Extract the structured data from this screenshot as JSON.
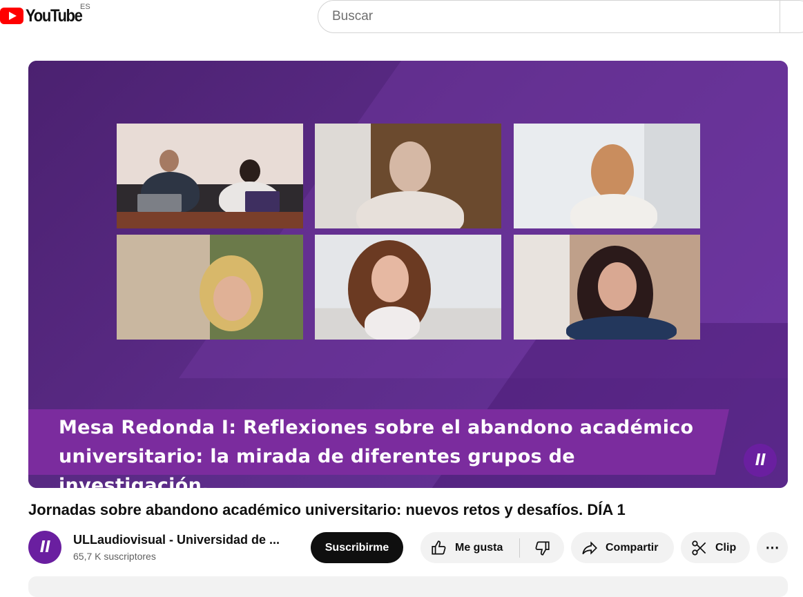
{
  "header": {
    "logo_text": "YouTube",
    "country_code": "ES",
    "search_placeholder": "Buscar"
  },
  "player": {
    "caption_line1": "Mesa Redonda I: Reflexiones sobre el abandono académico",
    "caption_line2": "universitario: la mirada de diferentes grupos de investigación.",
    "colors": {
      "background": "#5a2a85",
      "caption_band": "#7b2c9e"
    }
  },
  "video": {
    "title": "Jornadas sobre abandono académico universitario: nuevos retos y desafíos. DÍA 1"
  },
  "channel": {
    "name": "ULLaudiovisual - Universidad de ...",
    "subscribers": "65,7 K suscriptores",
    "subscribe_label": "Suscribirme"
  },
  "actions": {
    "like_label": "Me gusta",
    "share_label": "Compartir",
    "clip_label": "Clip",
    "more_label": "⋯"
  }
}
